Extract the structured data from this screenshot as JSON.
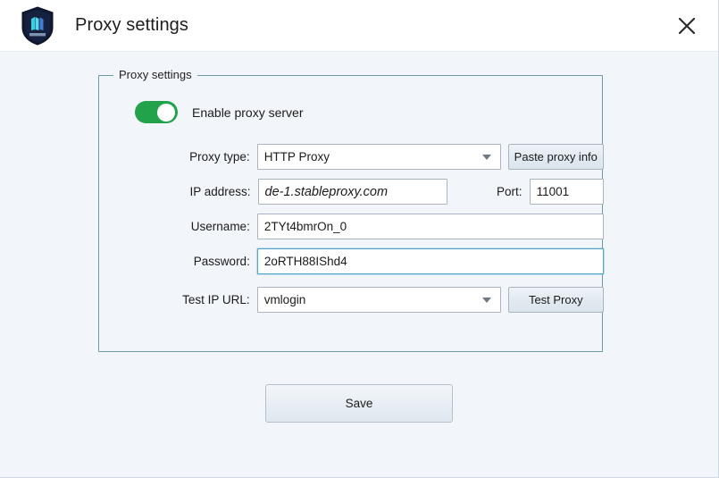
{
  "window": {
    "title": "Proxy settings",
    "logo_icon": "shield-logo-icon",
    "close_icon": "close-icon"
  },
  "group": {
    "legend": "Proxy settings"
  },
  "toggle": {
    "label": "Enable proxy server",
    "state": "on",
    "on_color": "#22a24b"
  },
  "fields": {
    "proxy_type": {
      "label": "Proxy type:",
      "value": "HTTP Proxy",
      "caret_icon": "chevron-down-icon"
    },
    "ip_address": {
      "label": "IP address:",
      "value": "de-1.stableproxy.com"
    },
    "port": {
      "label": "Port:",
      "value": "11001"
    },
    "username": {
      "label": "Username:",
      "value": "2TYt4bmrOn_0"
    },
    "password": {
      "label": "Password:",
      "value": "2oRTH88IShd4"
    },
    "test_ip_url": {
      "label": "Test IP URL:",
      "value": "vmlogin",
      "caret_icon": "chevron-down-icon"
    }
  },
  "buttons": {
    "paste_proxy_info": "Paste proxy info",
    "test_proxy": "Test Proxy",
    "save": "Save"
  }
}
